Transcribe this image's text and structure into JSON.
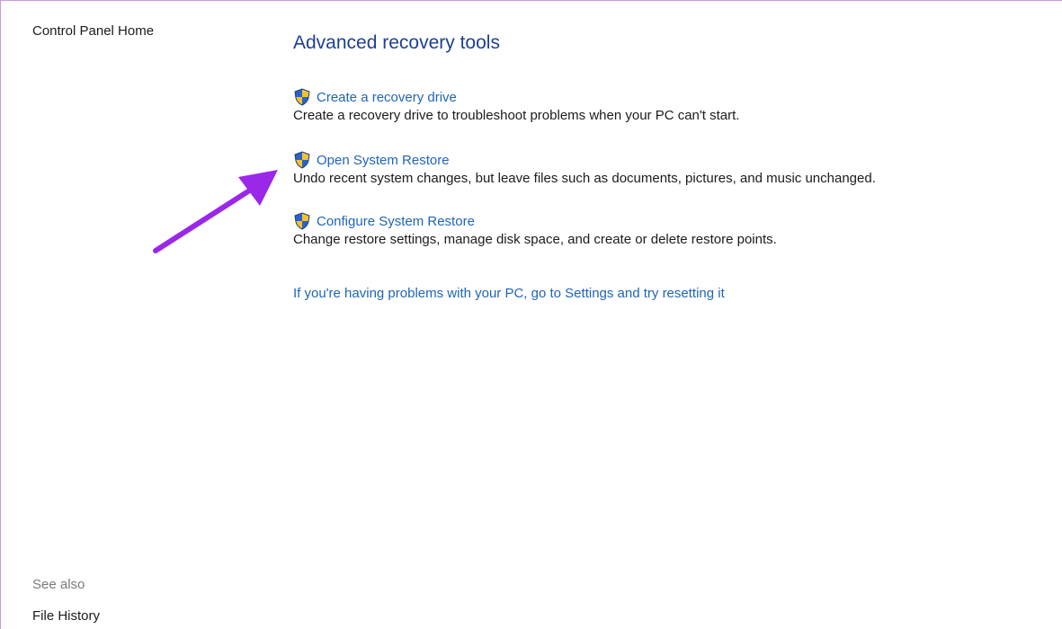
{
  "sidebar": {
    "home_label": "Control Panel Home",
    "see_also_label": "See also",
    "file_history_label": "File History"
  },
  "main": {
    "title": "Advanced recovery tools",
    "tools": [
      {
        "label": "Create a recovery drive",
        "description": "Create a recovery drive to troubleshoot problems when your PC can't start.",
        "icon": "uac-shield-icon"
      },
      {
        "label": "Open System Restore",
        "description": "Undo recent system changes, but leave files such as documents, pictures, and music unchanged.",
        "icon": "uac-shield-icon"
      },
      {
        "label": "Configure System Restore",
        "description": "Change restore settings, manage disk space, and create or delete restore points.",
        "icon": "uac-shield-icon"
      }
    ],
    "reset_link": "If you're having problems with your PC, go to Settings and try resetting it"
  },
  "colors": {
    "link": "#1f64b8",
    "title": "#1e3f91",
    "annotation_arrow": "#9b27e8",
    "shield_blue": "#2a63c4",
    "shield_yellow": "#f2c230"
  }
}
